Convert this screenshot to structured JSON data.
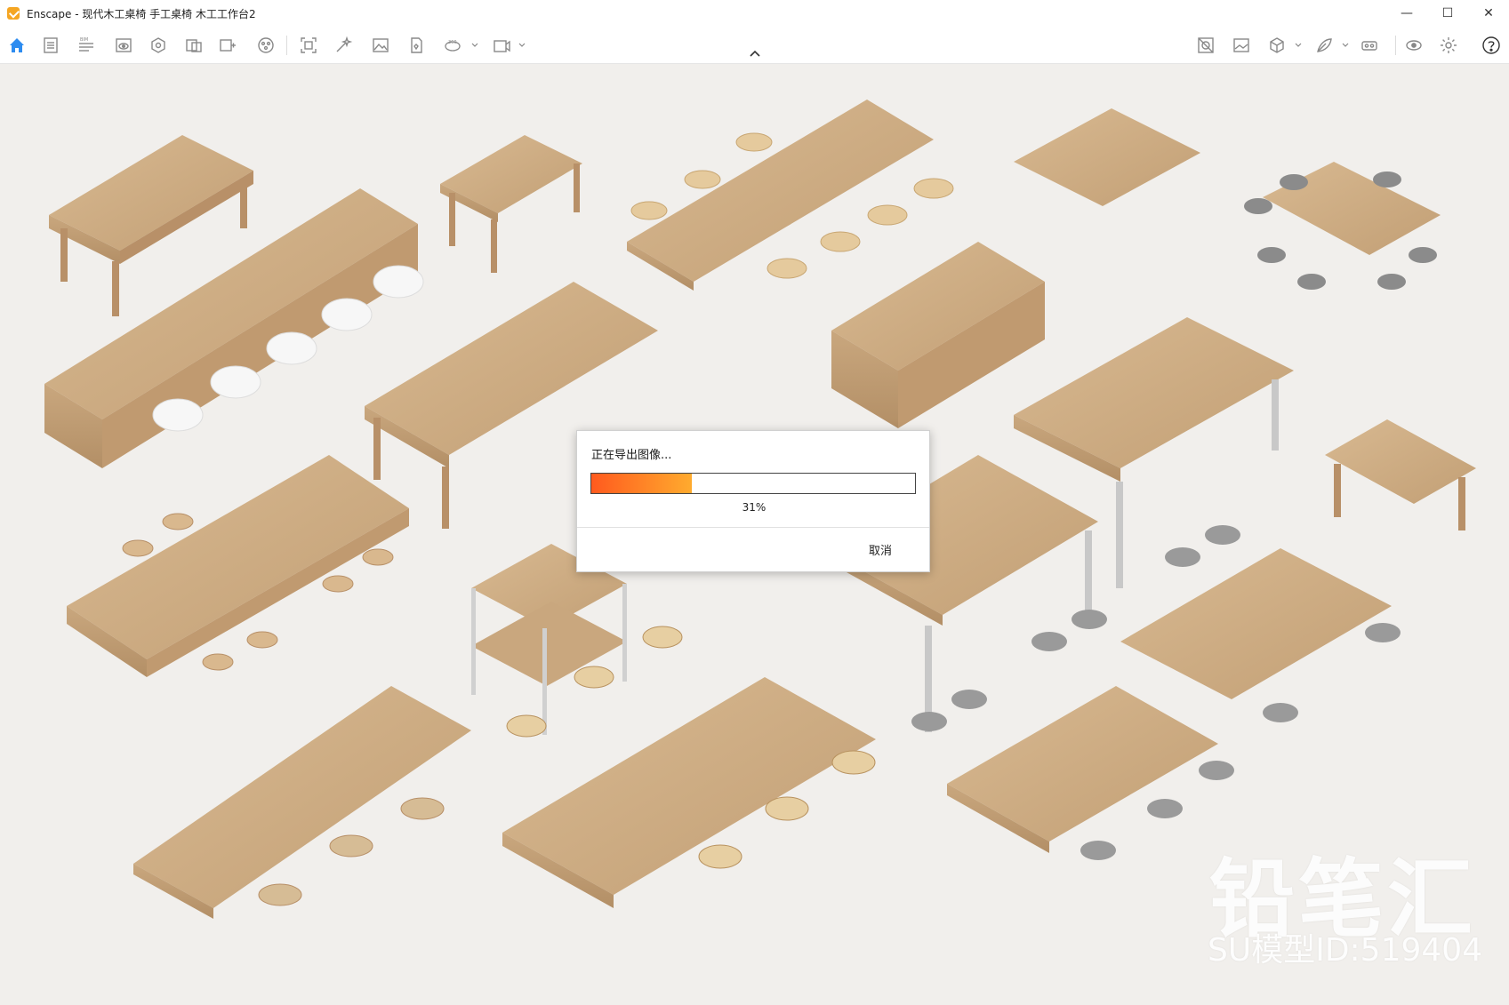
{
  "window": {
    "title": "Enscape - 现代木工桌椅 手工桌椅 木工工作台2",
    "minimize_glyph": "—",
    "maximize_glyph": "☐",
    "close_glyph": "✕"
  },
  "toolbar": {
    "left_icons": [
      "home-icon",
      "document-icon",
      "bim-icon",
      "preview-window-icon",
      "asset-library-icon",
      "views-icon",
      "capture-view-icon",
      "mesh-icon",
      "screenshot-icon",
      "batch-render-icon",
      "image-icon",
      "panorama-icon",
      "360-video-icon",
      "video-editor-icon"
    ],
    "right_icons": [
      "material-editor-icon",
      "atmosphere-icon",
      "cube-icon",
      "render-style-icon",
      "vr-headset-icon",
      "visual-settings-icon",
      "settings-icon",
      "help-icon"
    ],
    "accent_color": "#2d8cf0"
  },
  "watermark": {
    "brand": "铅笔汇",
    "model_id": "SU模型ID:519404"
  },
  "dialog": {
    "title": "正在导出图像...",
    "progress_fraction": 0.31,
    "progress_label": "31%",
    "cancel_label": "取消",
    "progress_colors": [
      "#ff5a1e",
      "#ffab2e"
    ]
  }
}
